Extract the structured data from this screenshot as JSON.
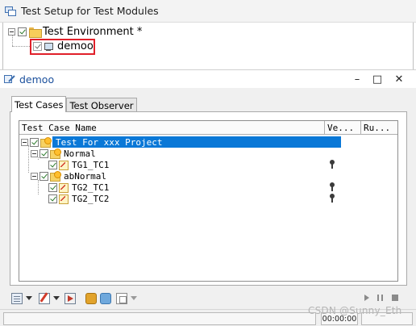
{
  "top_pane": {
    "title": "Test Setup for Test Modules",
    "tree": {
      "environment_label": "Test Environment *",
      "module_label": "demoo"
    }
  },
  "window": {
    "title": "demoo",
    "controls": {
      "minimize": "–",
      "maximize": "□",
      "close": "✕"
    },
    "tabs": [
      {
        "label": "Test Cases",
        "active": true
      },
      {
        "label": "Test Observer",
        "active": false
      }
    ],
    "columns": [
      "Test Case Name",
      "Ve...",
      "Ru..."
    ],
    "tree_rows": [
      {
        "label": "Test For xxx Project",
        "kind": "group",
        "selected": true
      },
      {
        "label": "Normal",
        "kind": "group"
      },
      {
        "label": "TG1_TC1",
        "kind": "testcase"
      },
      {
        "label": "abNormal",
        "kind": "group"
      },
      {
        "label": "TG2_TC1",
        "kind": "testcase"
      },
      {
        "label": "TG2_TC2",
        "kind": "testcase"
      }
    ],
    "status": {
      "time": "00:00:00"
    }
  },
  "watermark": "CSDN @Sunny_Eth",
  "colors": {
    "selection": "#0a78d7",
    "highlight_box": "#e0202a",
    "window_title": "#1a4f9c"
  }
}
